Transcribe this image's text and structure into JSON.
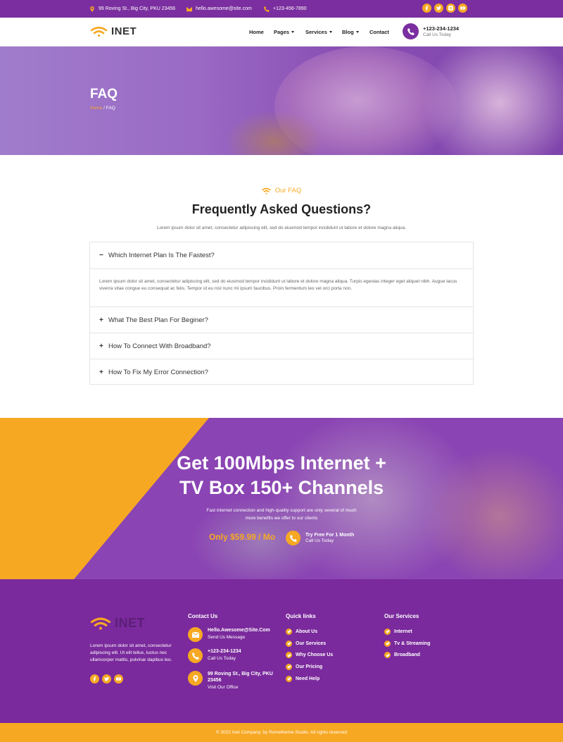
{
  "topbar": {
    "address": "99 Roving St., Big City, PKU 23456",
    "email": "hello.awesome@site.com",
    "phone": "+123-456-7890",
    "social": [
      "facebook-icon",
      "twitter-icon",
      "instagram-icon",
      "youtube-icon"
    ]
  },
  "brand": {
    "name": "INET",
    "accent": "#f7a823",
    "purple": "#7a2e9f"
  },
  "nav": {
    "items": [
      {
        "label": "Home"
      },
      {
        "label": "Pages"
      },
      {
        "label": "Services"
      },
      {
        "label": "Blog"
      },
      {
        "label": "Contact"
      }
    ],
    "call_number": "+123-234-1234",
    "call_label": "Call Us Today"
  },
  "hero": {
    "title": "FAQ",
    "breadcrumb_home": "Home",
    "breadcrumb_sep": " / ",
    "breadcrumb_current": "FAQ"
  },
  "faq": {
    "kicker": "Our FAQ",
    "title": "Frequently Asked Questions?",
    "subtitle": "Lorem ipsum dolor sit amet, consectetur adipiscing elit, sed do eiusmod tempor incididunt ut labore et dolore magna aliqua.",
    "items": [
      {
        "sign": "−",
        "question": "Which Internet Plan Is The Fastest?",
        "answer": "Lorem ipsum dolor sit amet, consectetur adipiscing elit, sed do eiusmod tempor incididunt ut labore et dolore magna aliqua. Turpis egestas integer eget aliquet nibh. Augue lacus viverra vitae congue eu consequat ac felis. Tempor id eu nisl nunc mi ipsum faucibus. Proin fermentum leo vel orci porta non."
      },
      {
        "sign": "+",
        "question": "What The Best Plan For Beginer?"
      },
      {
        "sign": "+",
        "question": "How To Connect With Broadband?"
      },
      {
        "sign": "+",
        "question": "How To Fix My Error Connection?"
      }
    ]
  },
  "promo": {
    "headline_1": "Get 100Mbps Internet +",
    "headline_2": "TV Box 150+ Channels",
    "text_1": "Fast internet connection and high-quality support are only several of much",
    "text_2": "more benefits we offer to our clients",
    "price": "Only $59.99 / Mo",
    "cta_title": "Try Free For 1 Month",
    "cta_sub": "Call Us Today"
  },
  "footer": {
    "description": "Lorem ipsum dolor sit amet, consectetur adipiscing elit. Ut elit tellus, luctus nec ullamcorper mattis, pulvinar dapibus leo.",
    "contact_title": "Contact Us",
    "contacts": [
      {
        "title": "Hello.Awesome@Site.Com",
        "sub": "Send Us Message"
      },
      {
        "title": "+123-234-1234",
        "sub": "Call Us Today"
      },
      {
        "title": "99 Roving St., Big City, PKU 23456",
        "sub": "Visit Our Office"
      }
    ],
    "quick_title": "Quick links",
    "quick_links": [
      "About Us",
      "Our Services",
      "Why Choose Us",
      "Our Pricing",
      "Need Help"
    ],
    "services_title": "Our Services",
    "services": [
      "Internet",
      "Tv & Streaming",
      "Broadband"
    ],
    "copyright": "© 2022 Inet Company. by Rometheme Studio. All rights reserved"
  }
}
